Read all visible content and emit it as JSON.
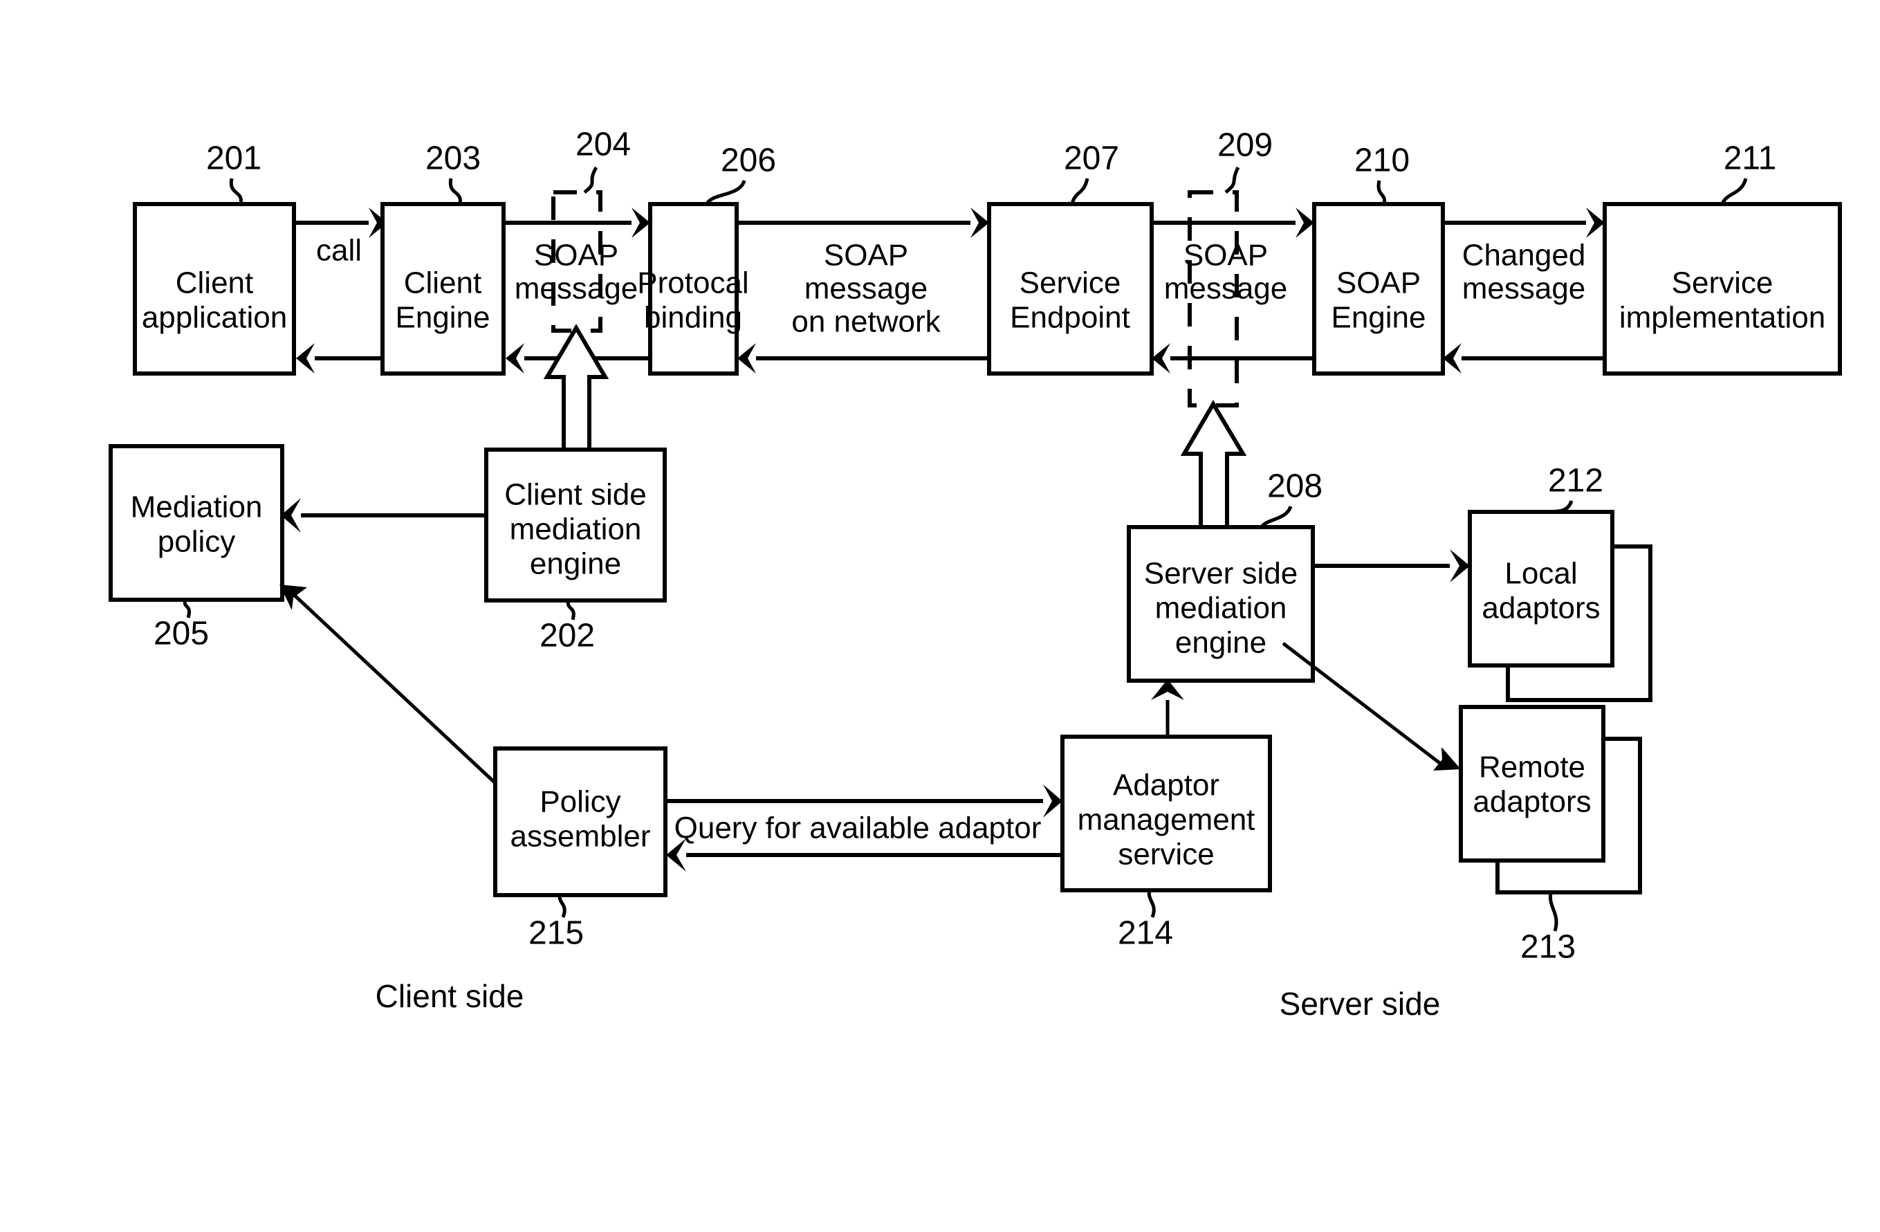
{
  "figure": {
    "kind": "patent-block-diagram",
    "background": "#ffffff",
    "ink": "#000000"
  },
  "boxes": {
    "client_application": {
      "label_line1": "Client",
      "label_line2": "application",
      "ref": "201"
    },
    "client_engine": {
      "label_line1": "Client",
      "label_line2": "Engine",
      "ref": "203"
    },
    "protocol_binding": {
      "label_line1": "Protocal",
      "label_line2": "binding",
      "ref": "206"
    },
    "service_endpoint": {
      "label_line1": "Service",
      "label_line2": "Endpoint",
      "ref": "207"
    },
    "soap_engine": {
      "label_line1": "SOAP",
      "label_line2": "Engine",
      "ref": "210"
    },
    "service_implementation": {
      "label_line1": "Service",
      "label_line2": "implementation",
      "ref": "211"
    },
    "mediation_policy": {
      "label_line1": "Mediation",
      "label_line2": "policy",
      "ref": "205"
    },
    "client_side_mediation_engine": {
      "label_line1": "Client side",
      "label_line2": "mediation",
      "label_line3": "engine",
      "ref": "202"
    },
    "server_side_mediation_engine": {
      "label_line1": "Server side",
      "label_line2": "mediation",
      "label_line3": "engine",
      "ref": "208"
    },
    "local_adaptors": {
      "label_line1": "Local",
      "label_line2": "adaptors",
      "ref": "212"
    },
    "remote_adaptors": {
      "label_line1": "Remote",
      "label_line2": "adaptors",
      "ref": "213"
    },
    "policy_assembler": {
      "label_line1": "Policy",
      "label_line2": "assembler",
      "ref": "215"
    },
    "adaptor_management_service": {
      "label_line1": "Adaptor",
      "label_line2": "management",
      "label_line3": "service",
      "ref": "214"
    }
  },
  "dashed_regions": {
    "soap_message_client": {
      "label_line1": "SOAP",
      "label_line2": "message",
      "ref": "204"
    },
    "soap_message_server": {
      "label_line1": "SOAP",
      "label_line2": "message",
      "ref": "209"
    }
  },
  "edge_labels": {
    "call": "call",
    "soap_message_on_network_line1": "SOAP",
    "soap_message_on_network_line2": "message",
    "soap_message_on_network_line3": "on network",
    "changed_message_line1": "Changed",
    "changed_message_line2": "message",
    "query_for_available_adaptor": "Query for available adaptor"
  },
  "region_labels": {
    "client_side": "Client side",
    "server_side": "Server side"
  }
}
